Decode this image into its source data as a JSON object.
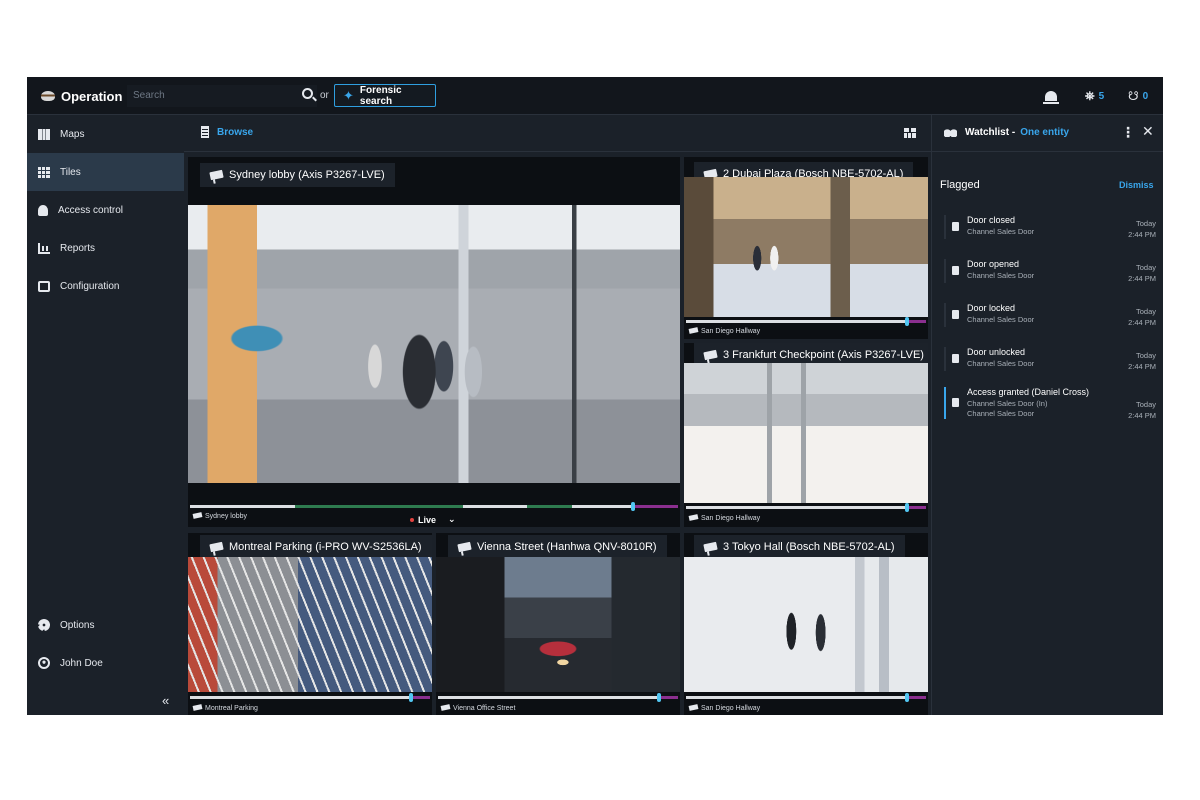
{
  "topbar": {
    "app_title": "Operation",
    "search_placeholder": "Search",
    "or_text": "or",
    "forensic_label": "Forensic search",
    "binoculars_count": "5",
    "watchlist_count": "0"
  },
  "sidebar": {
    "items": [
      {
        "label": "Maps",
        "icon": "map-icon"
      },
      {
        "label": "Tiles",
        "icon": "tiles-icon",
        "active": true
      },
      {
        "label": "Access control",
        "icon": "access-control-icon"
      },
      {
        "label": "Reports",
        "icon": "reports-icon"
      },
      {
        "label": "Configuration",
        "icon": "configuration-icon"
      }
    ],
    "options_label": "Options",
    "user_label": "John Doe"
  },
  "browse": {
    "label": "Browse"
  },
  "tiles": [
    {
      "title": "Sydney lobby (Axis P3267-LVE)",
      "footer": "Sydney lobby",
      "live_label": "Live"
    },
    {
      "title": "2 Dubai Plaza (Bosch NBE-5702-AL)",
      "footer": "San Diego Hallway"
    },
    {
      "title": "3 Frankfurt Checkpoint (Axis P3267-LVE)",
      "footer": "San Diego Hallway"
    },
    {
      "title": "Montreal Parking (i-PRO WV-S2536LA)",
      "footer": "Montreal Parking"
    },
    {
      "title": "Vienna Street (Hanhwa QNV-8010R)",
      "footer": "Vienna Office Street"
    },
    {
      "title": "3 Tokyo Hall (Bosch NBE-5702-AL)",
      "footer": "San Diego Hallway"
    }
  ],
  "watchlist": {
    "title": "Watchlist -",
    "entity": "One entity",
    "flagged_label": "Flagged",
    "dismiss_label": "Dismiss",
    "events": [
      {
        "title": "Door closed",
        "sub1": "Channel Sales Door",
        "sub2": "",
        "day": "Today",
        "time": "2:44 PM"
      },
      {
        "title": "Door opened",
        "sub1": "Channel Sales Door",
        "sub2": "",
        "day": "Today",
        "time": "2:44 PM"
      },
      {
        "title": "Door locked",
        "sub1": "Channel Sales Door",
        "sub2": "",
        "day": "Today",
        "time": "2:44 PM"
      },
      {
        "title": "Door unlocked",
        "sub1": "Channel Sales Door",
        "sub2": "",
        "day": "Today",
        "time": "2:44 PM"
      },
      {
        "title": "Access granted (Daniel Cross)",
        "sub1": "Channel Sales Door (In)",
        "sub2": "Channel Sales Door",
        "day": "Today",
        "time": "2:44 PM",
        "selected": true
      }
    ]
  },
  "colors": {
    "accent": "#39a6ec",
    "background": "#1b2129",
    "topbar": "#12161c",
    "active_nav": "#2b3a4a",
    "live_dot": "#e2433f"
  }
}
